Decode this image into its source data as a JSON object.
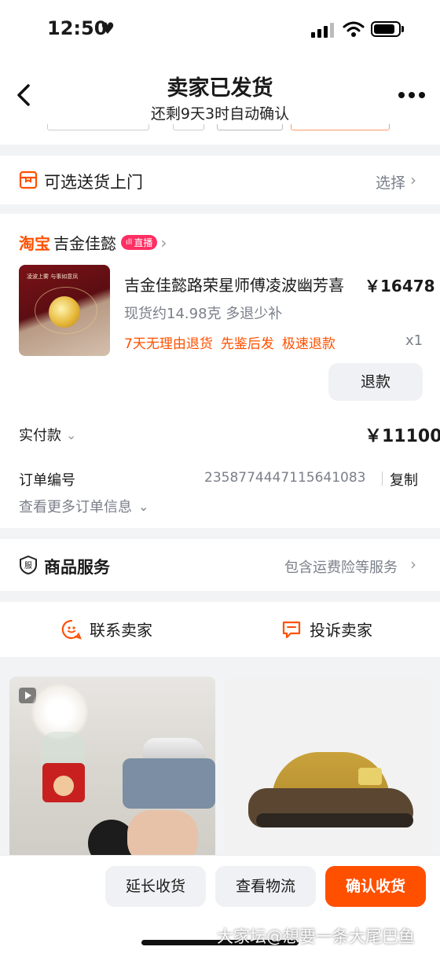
{
  "status_bar": {
    "time": "12:50",
    "heart": "♥"
  },
  "header": {
    "title": "卖家已发货",
    "subtitle": "还剩9天3时自动确认"
  },
  "delivery": {
    "label": "可选送货上门",
    "action": "选择"
  },
  "shop": {
    "platform": "淘宝",
    "name": "吉金佳懿",
    "live_badge": "直播"
  },
  "product": {
    "title": "吉金佳懿路荣星师傅凌波幽芳喜",
    "price": "￥16478",
    "spec": "现货约14.98克 多退少补",
    "tags": [
      "7天无理由退货",
      "先鉴后发",
      "极速退款"
    ],
    "quantity": "x1",
    "thumb_text": "凌波上雾 与事如意凤",
    "refund_label": "退款"
  },
  "payment": {
    "label": "实付款",
    "amount": "￥11100"
  },
  "order": {
    "number_label": "订单编号",
    "number": "2358774447115641083",
    "copy_label": "复制",
    "more_label": "查看更多订单信息"
  },
  "service": {
    "label": "商品服务",
    "detail": "包含运费险等服务"
  },
  "contact": {
    "seller": "联系卖家",
    "complain": "投诉卖家"
  },
  "bottom_bar": {
    "extend": "延长收货",
    "logistics": "查看物流",
    "confirm": "确认收货"
  },
  "watermark": "大家坛@想要一条大尾巴鱼",
  "colors": {
    "accent": "#ff5000",
    "live": "#ff2e63",
    "page_bg": "#f2f3f5"
  }
}
